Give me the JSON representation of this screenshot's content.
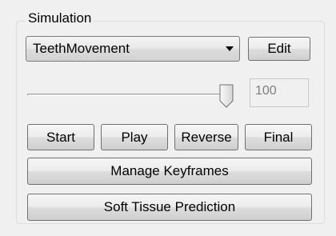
{
  "simulation": {
    "group_title": "Simulation",
    "model_select": {
      "selected": "TeethMovement",
      "options": [
        "TeethMovement"
      ]
    },
    "edit_label": "Edit",
    "slider_value": 100,
    "value_display": "100",
    "playback": {
      "start_label": "Start",
      "play_label": "Play",
      "reverse_label": "Reverse",
      "final_label": "Final"
    },
    "manage_keyframes_label": "Manage Keyframes",
    "soft_tissue_label": "Soft Tissue Prediction"
  }
}
